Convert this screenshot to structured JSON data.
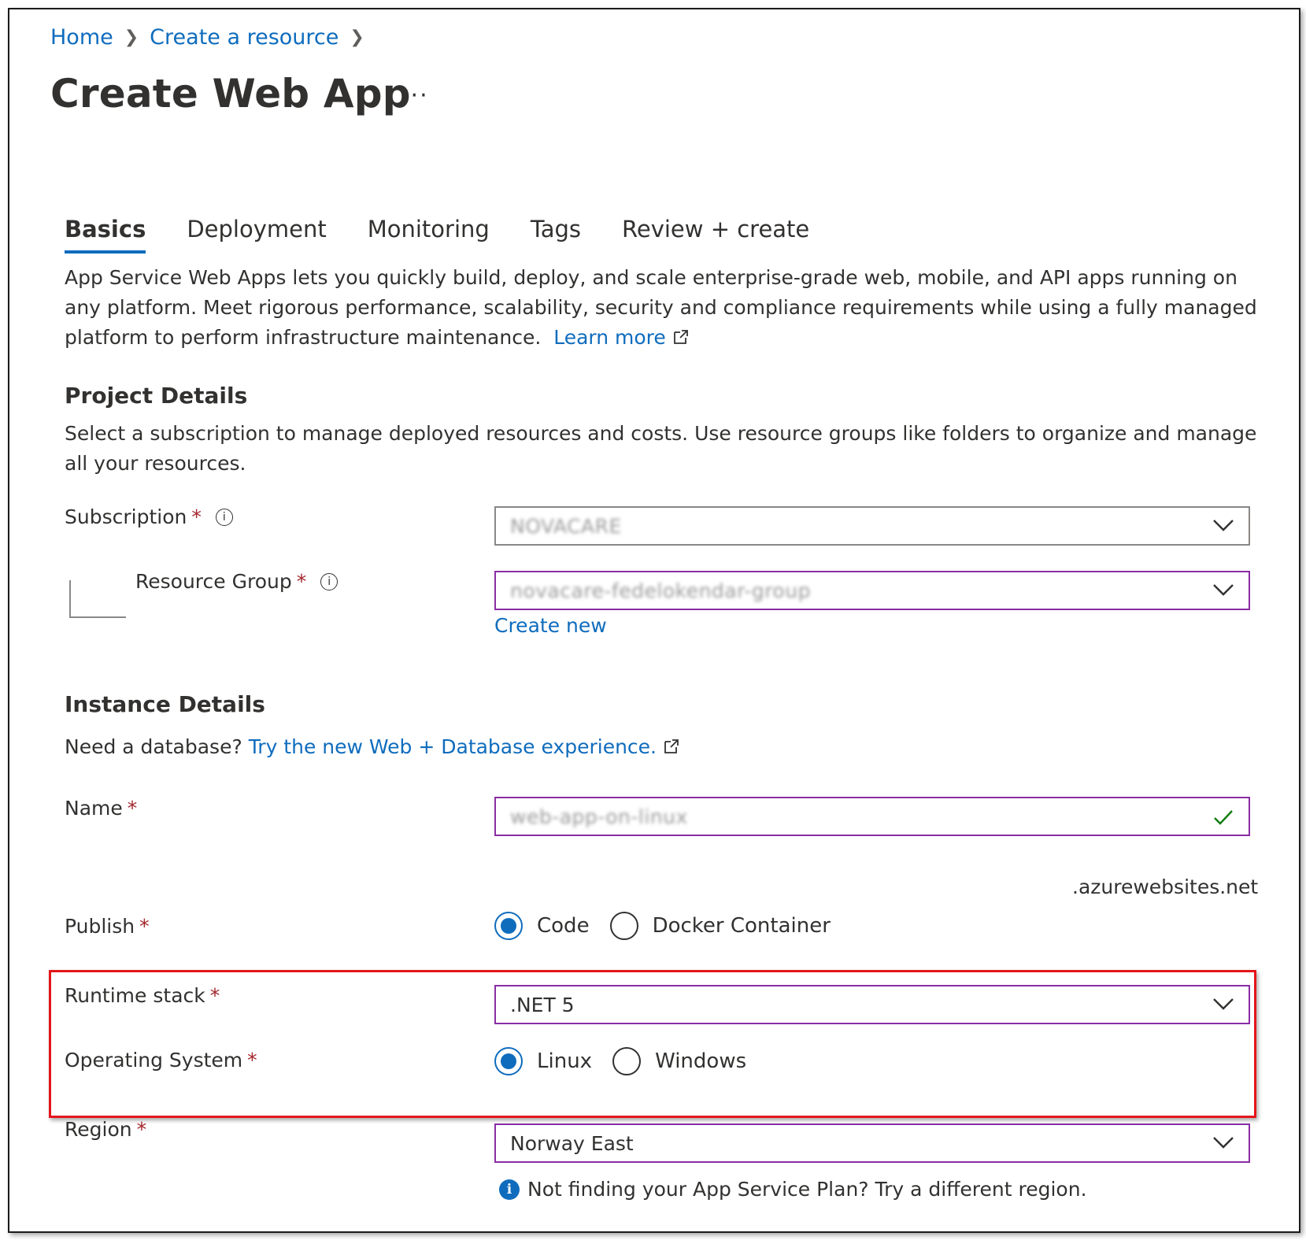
{
  "breadcrumb": {
    "items": [
      "Home",
      "Create a resource"
    ]
  },
  "page": {
    "title": "Create Web App",
    "more_label": "···"
  },
  "tabs": [
    {
      "label": "Basics",
      "active": true
    },
    {
      "label": "Deployment",
      "active": false
    },
    {
      "label": "Monitoring",
      "active": false
    },
    {
      "label": "Tags",
      "active": false
    },
    {
      "label": "Review + create",
      "active": false
    }
  ],
  "intro": {
    "text": "App Service Web Apps lets you quickly build, deploy, and scale enterprise-grade web, mobile, and API apps running on any platform. Meet rigorous performance, scalability, security and compliance requirements while using a fully managed platform to perform infrastructure maintenance.",
    "learn_more": "Learn more"
  },
  "project": {
    "heading": "Project Details",
    "description": "Select a subscription to manage deployed resources and costs. Use resource groups like folders to organize and manage all your resources.",
    "subscription_label": "Subscription",
    "subscription_value": "NOVACARE",
    "resource_group_label": "Resource Group",
    "resource_group_value": "novacare-fedelokendar-group",
    "create_new": "Create new"
  },
  "instance": {
    "heading": "Instance Details",
    "db_prompt": "Need a database?",
    "db_link": "Try the new Web + Database experience.",
    "name_label": "Name",
    "name_value": "web-app-on-linux",
    "name_suffix": ".azurewebsites.net",
    "publish_label": "Publish",
    "publish_options": [
      "Code",
      "Docker Container"
    ],
    "publish_selected": "Code",
    "runtime_label": "Runtime stack",
    "runtime_value": ".NET 5",
    "os_label": "Operating System",
    "os_options": [
      "Linux",
      "Windows"
    ],
    "os_selected": "Linux",
    "region_label": "Region",
    "region_value": "Norway East",
    "region_hint": "Not finding your App Service Plan? Try a different region."
  },
  "required_marker": "*",
  "colors": {
    "accent": "#0f6cbd",
    "required": "#a4262c",
    "focus_border": "#8a2da5",
    "highlight": "#e3161b",
    "valid": "#107c10"
  }
}
